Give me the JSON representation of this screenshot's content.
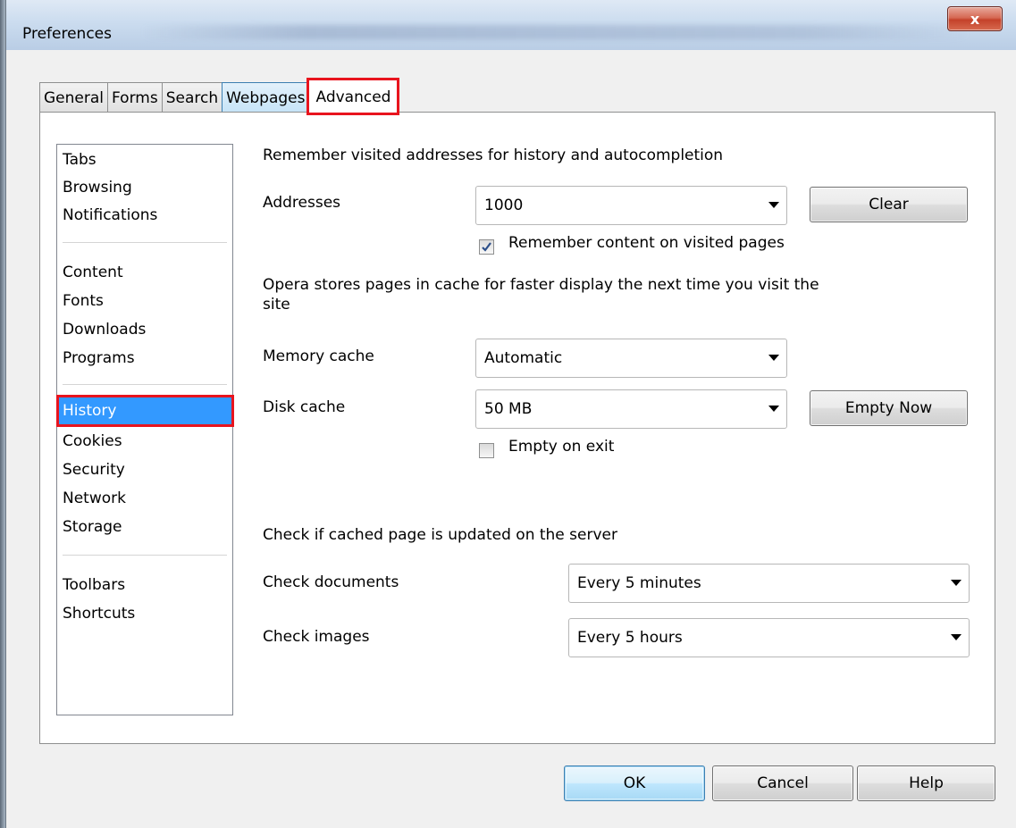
{
  "window": {
    "title": "Preferences",
    "close_glyph": "x"
  },
  "tabs": [
    {
      "label": "General"
    },
    {
      "label": "Forms"
    },
    {
      "label": "Search"
    },
    {
      "label": "Webpages"
    },
    {
      "label": "Advanced",
      "selected": true
    }
  ],
  "sidebar": {
    "groups": [
      [
        "Tabs",
        "Browsing",
        "Notifications"
      ],
      [
        "Content",
        "Fonts",
        "Downloads",
        "Programs"
      ],
      [
        "History",
        "Cookies",
        "Security",
        "Network",
        "Storage"
      ],
      [
        "Toolbars",
        "Shortcuts"
      ]
    ],
    "selected": "History"
  },
  "history": {
    "remember_heading": "Remember visited addresses for history and autocompletion",
    "addresses_label": "Addresses",
    "addresses_value": "1000",
    "clear_button": "Clear",
    "remember_content_label": "Remember content on visited pages",
    "remember_content_checked": true,
    "cache_heading_line1": "Opera stores pages in cache for faster display the next time you visit the",
    "cache_heading_line2": "site",
    "memory_cache_label": "Memory cache",
    "memory_cache_value": "Automatic",
    "disk_cache_label": "Disk cache",
    "disk_cache_value": "50 MB",
    "empty_now_button": "Empty Now",
    "empty_on_exit_label": "Empty on exit",
    "empty_on_exit_checked": false,
    "check_heading": "Check if cached page is updated on the server",
    "check_documents_label": "Check documents",
    "check_documents_value": "Every 5 minutes",
    "check_images_label": "Check images",
    "check_images_value": "Every 5 hours"
  },
  "footer": {
    "ok": "OK",
    "cancel": "Cancel",
    "help": "Help"
  }
}
